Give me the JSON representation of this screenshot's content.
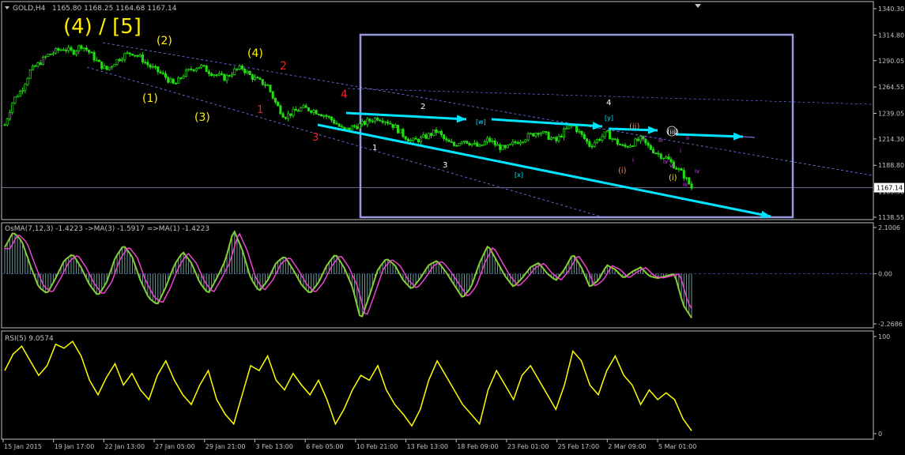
{
  "window": {
    "symbol_label": "GOLD,H4",
    "ohlc": "1165.80 1168.25 1164.68 1167.14",
    "menu_icon": "triangle-down-icon",
    "scroll_icon": "triangle-down-icon"
  },
  "colors": {
    "background": "#000000",
    "grid_border": "#c0c0c0",
    "candle": "#22dd11",
    "cyan_arrow": "#00e5ff",
    "channel": "#7a7aff",
    "box": "#9a9ae0",
    "wave_yellow": "#ffee00",
    "wave_red": "#ee2222",
    "wave_white": "#ffffff",
    "wave_magenta": "#dd44ff",
    "wave_orange": "#ff8844",
    "osma_hist": "#6a9a9a",
    "osma_signal": "#ee44cc",
    "osma_main": "#88cc33",
    "rsi_line": "#ffff00"
  },
  "chart_data": [
    {
      "type": "candlestick",
      "title": "GOLD,H4",
      "ylim": [
        1138.55,
        1340.3
      ],
      "y_ticks": [
        "1340.30",
        "1314.80",
        "1290.05",
        "1264.55",
        "1239.05",
        "1214.30",
        "1188.80",
        "1163.30",
        "1138.55"
      ],
      "current_price": "1167.14",
      "close_path": [
        1228,
        1252,
        1262,
        1280,
        1287,
        1295,
        1299,
        1302,
        1298,
        1305,
        1298,
        1288,
        1281,
        1289,
        1295,
        1298,
        1293,
        1285,
        1280,
        1274,
        1266,
        1276,
        1282,
        1285,
        1280,
        1276,
        1273,
        1280,
        1283,
        1275,
        1270,
        1266,
        1248,
        1236,
        1240,
        1244,
        1243,
        1240,
        1236,
        1230,
        1222,
        1226,
        1228,
        1232,
        1235,
        1232,
        1226,
        1218,
        1212,
        1214,
        1218,
        1222,
        1212,
        1208,
        1214,
        1210,
        1206,
        1214,
        1208,
        1204,
        1210,
        1214,
        1218,
        1222,
        1217,
        1212,
        1222,
        1228,
        1218,
        1208,
        1214,
        1220,
        1212,
        1206,
        1210,
        1214,
        1206,
        1200,
        1196,
        1188,
        1180,
        1167
      ],
      "wave_labels": [
        {
          "text": "(4) / [5]",
          "color": "yellow",
          "size": "big"
        },
        {
          "text": "(2)",
          "color": "yellow"
        },
        {
          "text": "(1)",
          "color": "yellow"
        },
        {
          "text": "(3)",
          "color": "yellow"
        },
        {
          "text": "(4)",
          "color": "yellow"
        },
        {
          "text": "2",
          "color": "red"
        },
        {
          "text": "1",
          "color": "red"
        },
        {
          "text": "4",
          "color": "red"
        },
        {
          "text": "3",
          "color": "red"
        },
        {
          "text": "2",
          "color": "white"
        },
        {
          "text": "1",
          "color": "white"
        },
        {
          "text": "3",
          "color": "white"
        },
        {
          "text": "4",
          "color": "white"
        },
        {
          "text": "[w]",
          "color": "cyan"
        },
        {
          "text": "[x]",
          "color": "cyan"
        },
        {
          "text": "[y]",
          "color": "cyan"
        },
        {
          "text": "(ii)",
          "color": "orange"
        },
        {
          "text": "(iii)",
          "color": "white"
        },
        {
          "text": "(i)",
          "color": "orange"
        },
        {
          "text": "(i)",
          "color": "yellow"
        },
        {
          "text": "ii",
          "color": "magenta"
        },
        {
          "text": "i",
          "color": "magenta"
        },
        {
          "text": "iii",
          "color": "magenta"
        },
        {
          "text": "iv",
          "color": "magenta"
        },
        {
          "text": "iv",
          "color": "magenta"
        },
        {
          "text": "v",
          "color": "magenta"
        },
        {
          "text": "ii",
          "color": "magenta"
        },
        {
          "text": "i",
          "color": "magenta"
        },
        {
          "text": "iii",
          "color": "magenta"
        }
      ]
    },
    {
      "type": "histogram",
      "title": "OsMA(7,12,3) -1.4223  ->MA(3) -1.5917  =>MA(1) -1.4223",
      "ylim": [
        -2.2686,
        2.1006
      ],
      "y_ticks": [
        "2.1006",
        "0.00",
        "-2.2686"
      ],
      "values": [
        1.2,
        1.9,
        1.5,
        0.4,
        -0.6,
        -0.9,
        -0.2,
        0.6,
        0.9,
        0.3,
        -0.5,
        -1.0,
        -0.4,
        0.7,
        1.3,
        0.8,
        -0.3,
        -1.1,
        -1.4,
        -0.6,
        0.4,
        1.0,
        0.5,
        -0.4,
        -0.9,
        -0.2,
        0.6,
        2.0,
        1.1,
        -0.2,
        -0.8,
        -0.3,
        0.5,
        0.8,
        0.2,
        -0.5,
        -0.9,
        -0.4,
        0.4,
        0.9,
        0.3,
        -0.6,
        -2.1,
        -1.0,
        0.2,
        0.7,
        0.4,
        -0.3,
        -0.7,
        -0.2,
        0.4,
        0.6,
        0.1,
        -0.5,
        -1.1,
        -0.6,
        0.5,
        1.3,
        0.6,
        -0.1,
        -0.6,
        -0.2,
        0.3,
        0.5,
        0.0,
        -0.3,
        0.2,
        0.9,
        0.3,
        -0.6,
        -0.3,
        0.4,
        0.2,
        -0.2,
        0.1,
        0.3,
        -0.1,
        -0.2,
        -0.1,
        0.0,
        -1.4,
        -2.0
      ]
    },
    {
      "type": "line",
      "title": "RSI(5) 9.0574",
      "ylim": [
        0,
        100
      ],
      "y_ticks": [
        "100",
        "0"
      ],
      "values": [
        65,
        82,
        90,
        75,
        60,
        70,
        92,
        88,
        95,
        80,
        55,
        40,
        58,
        72,
        50,
        62,
        45,
        35,
        60,
        75,
        55,
        40,
        30,
        50,
        65,
        35,
        20,
        10,
        40,
        70,
        65,
        80,
        55,
        45,
        62,
        50,
        40,
        55,
        35,
        10,
        25,
        45,
        60,
        55,
        70,
        45,
        30,
        20,
        8,
        25,
        55,
        75,
        60,
        45,
        30,
        20,
        10,
        45,
        65,
        50,
        35,
        60,
        70,
        55,
        40,
        25,
        50,
        85,
        75,
        50,
        40,
        65,
        80,
        60,
        50,
        30,
        45,
        35,
        42,
        35,
        15,
        3
      ],
      "x_ticks": [
        "15 Jan 2015",
        "19 Jan 17:00",
        "22 Jan 13:00",
        "27 Jan 05:00",
        "29 Jan 21:00",
        "3 Feb 13:00",
        "6 Feb 05:00",
        "10 Feb 21:00",
        "13 Feb 13:00",
        "18 Feb 09:00",
        "23 Feb 01:00",
        "25 Feb 17:00",
        "2 Mar 09:00",
        "5 Mar 01:00"
      ]
    }
  ]
}
